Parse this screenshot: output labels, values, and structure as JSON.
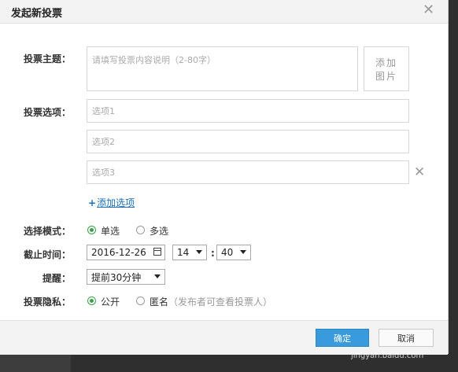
{
  "dialog": {
    "title": "发起新投票"
  },
  "topic": {
    "label": "投票主题：",
    "placeholder": "请填写投票内容说明（2-80字）",
    "add_image_line1": "添加",
    "add_image_line2": "图片"
  },
  "options": {
    "label": "投票选项：",
    "items": [
      {
        "placeholder": "选项1"
      },
      {
        "placeholder": "选项2"
      },
      {
        "placeholder": "选项3"
      }
    ],
    "add_plus": "+",
    "add_label": "添加选项"
  },
  "mode": {
    "label": "选择模式：",
    "single": "单选",
    "multi": "多选",
    "selected": "single"
  },
  "deadline": {
    "label": "截止时间：",
    "date": "2016-12-26",
    "hour": "14",
    "colon": ":",
    "minute": "40"
  },
  "reminder": {
    "label": "提醒：",
    "value": "提前30分钟"
  },
  "privacy": {
    "label": "投票隐私：",
    "public": "公开",
    "anonymous": "匿名",
    "anonymous_note": "（发布者可查看投票人）",
    "selected": "public"
  },
  "footer": {
    "ok_label": "确定",
    "cancel_label": "取消"
  },
  "watermark": "jingyan.baidu.com",
  "colors": {
    "accent": "#3a9bdc",
    "radio_on": "#3aa14b",
    "link": "#1a6fb8"
  }
}
